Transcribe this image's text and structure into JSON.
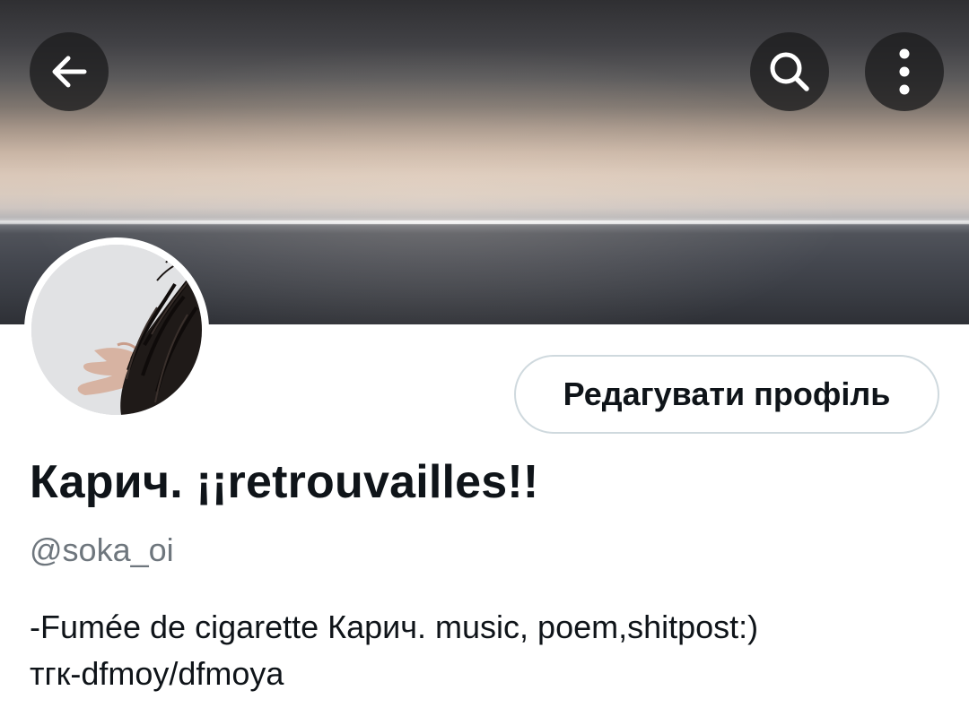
{
  "header": {
    "back_icon": "arrow-left-icon",
    "search_icon": "search-icon",
    "more_icon": "more-vertical-icon"
  },
  "profile": {
    "edit_button_label": "Редагувати профіль",
    "display_name": "Карич. ¡¡retrouvailles!!",
    "handle": "@soka_oi",
    "bio_lines": [
      "-Fumée de cigarette Карич. music, poem,shitpost:)",
      "тгк-dfmoy/dfmoya"
    ]
  },
  "colors": {
    "primary_text": "#0f1419",
    "secondary_text": "#6e767d",
    "button_border": "#cfd9de",
    "overlay_button_bg": "#1c1c1e"
  }
}
